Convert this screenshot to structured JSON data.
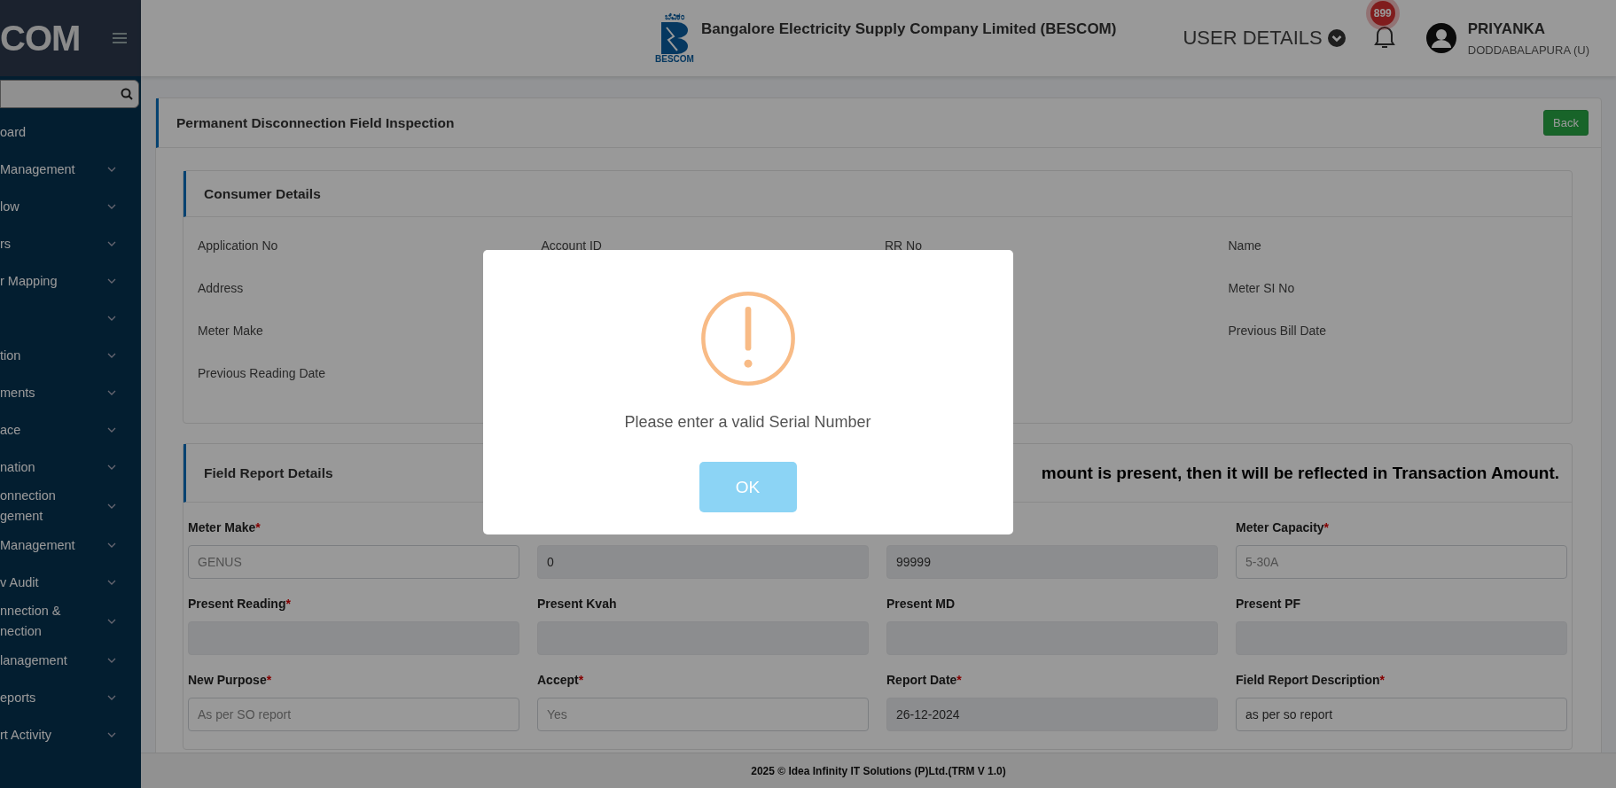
{
  "sidebar": {
    "brand": "COM",
    "items": [
      {
        "label": "oard",
        "has_submenu": false
      },
      {
        "label": "Management",
        "has_submenu": true
      },
      {
        "label": "low",
        "has_submenu": true
      },
      {
        "label": "rs",
        "has_submenu": true
      },
      {
        "label": "r Mapping",
        "has_submenu": true
      },
      {
        "has_submenu": true
      },
      {
        "label": "tion",
        "has_submenu": true
      },
      {
        "label": "ments",
        "has_submenu": true
      },
      {
        "label": "ace",
        "has_submenu": true
      },
      {
        "label": "nation",
        "has_submenu": true
      },
      {
        "label": "onnection\ngement",
        "has_submenu": true
      },
      {
        "label": " Management",
        "has_submenu": true
      },
      {
        "label": "v Audit",
        "has_submenu": true
      },
      {
        "label": "nnection &\nnection",
        "has_submenu": true
      },
      {
        "label": "lanagement",
        "has_submenu": true
      },
      {
        "label": "eports",
        "has_submenu": true
      },
      {
        "label": "rt Activity",
        "has_submenu": true
      }
    ]
  },
  "header": {
    "company": "Bangalore Electricity Supply Company Limited (BESCOM)",
    "logo_caption": "BESCOM",
    "logo_top": "ಬೆವಿಕಂ",
    "user_details": "USER DETAILS",
    "notification_count": "899",
    "user_name": "PRIYANKA",
    "user_location": "DODDABALAPURA (U)"
  },
  "page": {
    "title": "Permanent Disconnection Field Inspection",
    "back_button": "Back"
  },
  "consumer_details": {
    "title": "Consumer Details",
    "columns": [
      [
        "Application No",
        "Address",
        "Meter Make",
        "Previous Reading Date"
      ],
      [
        "Account ID"
      ],
      [
        "RR No"
      ],
      [
        "Name",
        "Meter SI No",
        "Previous Bill Date"
      ]
    ]
  },
  "field_report": {
    "title": "Field Report Details",
    "required_mark": "*",
    "notice": "mount is present, then it will be reflected in Transaction Amount.",
    "fields": [
      {
        "label": "Meter Make",
        "required": true,
        "placeholder": "GENUS",
        "disabled": false
      },
      {
        "value": "0",
        "disabled": true
      },
      {
        "value": "99999",
        "disabled": true
      },
      {
        "label": "Meter Capacity",
        "required": true,
        "placeholder": "5-30A",
        "disabled": false
      },
      {
        "label": "Present Reading",
        "required": true,
        "disabled": true
      },
      {
        "label": "Present Kvah",
        "required": false,
        "disabled": true
      },
      {
        "label": "Present MD",
        "required": false,
        "disabled": true
      },
      {
        "label": "Present PF",
        "required": false,
        "disabled": true
      },
      {
        "label": "New Purpose",
        "required": true,
        "placeholder": "As per SO report",
        "disabled": false
      },
      {
        "label": "Accept",
        "required": true,
        "placeholder": "Yes",
        "disabled": false
      },
      {
        "label": "Report Date",
        "required": true,
        "value": "26-12-2024",
        "disabled": true
      },
      {
        "label": "Field Report Description",
        "required": true,
        "value": "as per so report",
        "disabled": false
      }
    ]
  },
  "modal": {
    "kind": "warning",
    "message": "Please enter a valid Serial Number",
    "button": "OK"
  },
  "footer": "2025 © Idea Infinity IT Solutions (P)Ltd.(TRM V 1.0)"
}
